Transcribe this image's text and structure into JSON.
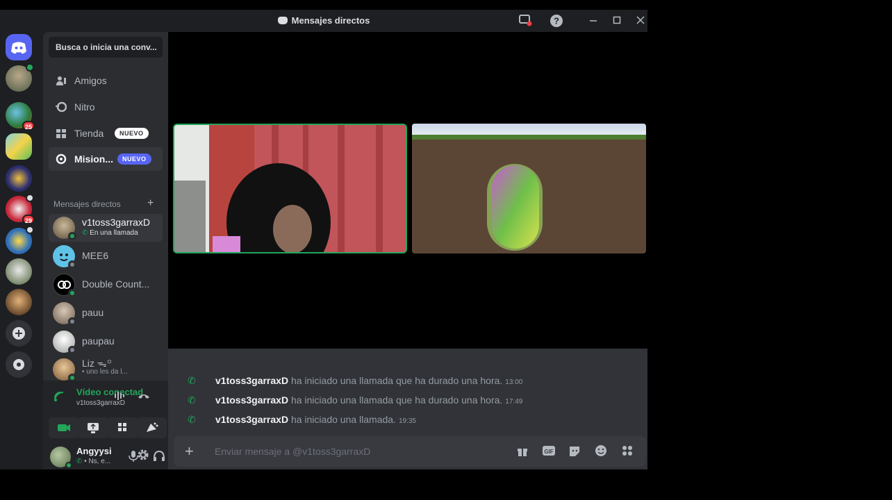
{
  "window": {
    "title": "Mensajes directos",
    "help_glyph": "?"
  },
  "colors": {
    "accent": "#5865f2",
    "online": "#23a55a",
    "danger": "#f23f43",
    "background": "#1e1f22",
    "sidebar": "#2b2d31",
    "chat": "#313338"
  },
  "servers": [
    {
      "icon": "discord-home-icon"
    },
    {
      "icon": "server-avatar-icon"
    },
    {
      "icon": "server-globe-icon",
      "badge": "25"
    },
    {
      "icon": "server-cartoon-icon"
    },
    {
      "icon": "server-drawing-icon"
    },
    {
      "icon": "server-red-icon",
      "badge": "29"
    },
    {
      "icon": "server-game-icon"
    },
    {
      "icon": "server-dog-icon"
    },
    {
      "icon": "server-cat-icon"
    }
  ],
  "sidebar": {
    "search_label": "Busca o inicia una conv...",
    "nav": [
      {
        "label": "Amigos",
        "icon": "friends-icon"
      },
      {
        "label": "Nitro",
        "icon": "nitro-icon"
      },
      {
        "label": "Tienda",
        "icon": "shop-icon",
        "tag": "NUEVO"
      },
      {
        "label": "Mision...",
        "icon": "quests-icon",
        "tag": "NUEVO"
      }
    ],
    "dm_header": "Mensajes directos",
    "dms": [
      {
        "name": "v1toss3garraxD",
        "sub": "En una llamada",
        "status": "online"
      },
      {
        "name": "MEE6",
        "status": "offline"
      },
      {
        "name": "Double Count...",
        "status": "online"
      },
      {
        "name": "pauu",
        "status": "offline"
      },
      {
        "name": "paupau",
        "status": "offline"
      },
      {
        "name": "Liz ᯓ꙳",
        "sub": "• uno les da l...",
        "status": "online"
      }
    ]
  },
  "voice": {
    "status": "Vídeo conectad",
    "channel": "v1toss3garraxD",
    "buttons": [
      "camera-icon",
      "screen-share-icon",
      "activity-icon",
      "soundboard-icon"
    ]
  },
  "user": {
    "name": "Angyysi",
    "status": "• Ns, e..."
  },
  "messages": [
    {
      "author": "v1toss3garraxD",
      "text": "ha iniciado una llamada que ha durado una hora.",
      "time": "13:00"
    },
    {
      "author": "v1toss3garraxD",
      "text": "ha iniciado una llamada que ha durado una hora.",
      "time": "17:49"
    },
    {
      "author": "v1toss3garraxD",
      "text": "ha iniciado una llamada.",
      "time": "19:35"
    }
  ],
  "composer": {
    "placeholder": "Enviar mensaje a @v1toss3garraxD",
    "gif_label": "GIF"
  }
}
